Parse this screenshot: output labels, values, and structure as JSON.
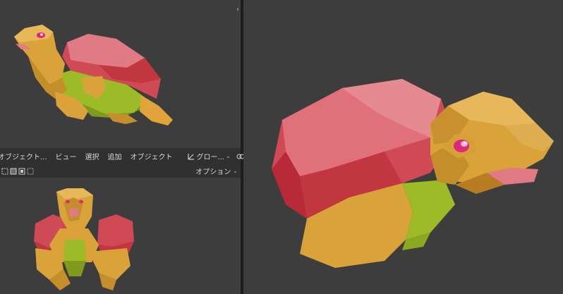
{
  "header": {
    "mode_label": "オブジェクト...",
    "menus": [
      "ビュー",
      "選択",
      "追加",
      "オブジェクト"
    ],
    "transform_orientation": "グロー...",
    "options_label": "オプション"
  },
  "icons": {
    "mode": "object-mode-icon",
    "transform": "transform-pivot-icon",
    "link": "link-icon",
    "snap": "snap-icon",
    "proportional": "proportional-edit-icon",
    "collapse": "chevron-left-icon"
  },
  "colors": {
    "viewport_bg": "#3d3d3d",
    "shell_red": "#d04a55",
    "shell_pink": "#e0707a",
    "body_yellow": "#d9a33a",
    "belly_green": "#9dbb26",
    "eye_pink": "#e0287a"
  }
}
